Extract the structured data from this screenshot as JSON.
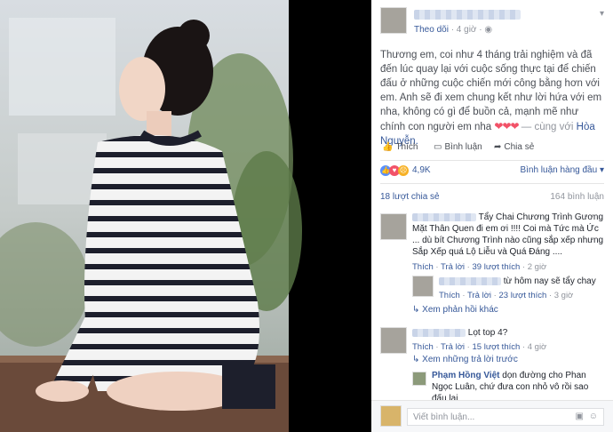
{
  "post": {
    "follow_label": "Theo dõi",
    "time": "· 4 giờ ·",
    "text": "Thương em, coi như 4 tháng trải nghiệm và đã đến lúc quay lại với cuộc sống thực tại để chiến đấu ở những cuộc chiến mới công bằng hơn với em. Anh sẽ đi xem chung kết như lời hứa với em nha, không có gì để buồn cả, mạnh mẽ như chính con người em nha",
    "hearts": "❤❤❤",
    "tagged_prefix": "— cùng với",
    "tagged_name": "Hòa Nguyễn.",
    "like_label": "Thích",
    "comment_label": "Bình luận",
    "share_label": "Chia sẻ"
  },
  "stats": {
    "reactions_count": "4,9K",
    "sort_label": "Bình luận hàng đầu",
    "shares": "18 lượt chia sẻ",
    "comments": "164 bình luận"
  },
  "comments": [
    {
      "text": "Tẩy Chai Chương Trình Gương Mặt Thân Quen đi em ơi !!!! Coi mà Tức mà Ức ... dù bít Chương Trình nào cũng sắp xếp nhưng Sắp Xếp quá Lộ Liễu và Quá Đáng ....",
      "like": "Thích",
      "reply": "Trả lời",
      "likes": "39 lượt thích",
      "time": "2 giờ"
    },
    {
      "text": "từ hôm nay sẽ tẩy chay",
      "like": "Thích",
      "reply": "Trả lời",
      "likes": "23 lượt thích",
      "time": "3 giờ"
    },
    {
      "more": "Xem phản hồi khác"
    },
    {
      "text": "Lọt top 4?",
      "like": "Thích",
      "reply": "Trả lời",
      "likes": "15 lượt thích",
      "time": "4 giờ"
    },
    {
      "more": "Xem những trả lời trước"
    },
    {
      "author": "Phạm Hồng Việt",
      "text": "dọn đường cho Phan Ngọc Luân, chứ đưa con nhỏ vô rồi sao đấu lại"
    }
  ],
  "write": {
    "placeholder": "Viết bình luận..."
  },
  "colors": {
    "link": "#365899",
    "muted": "#90949c",
    "heart": "#f25268",
    "like_blue": "#5890ff"
  }
}
